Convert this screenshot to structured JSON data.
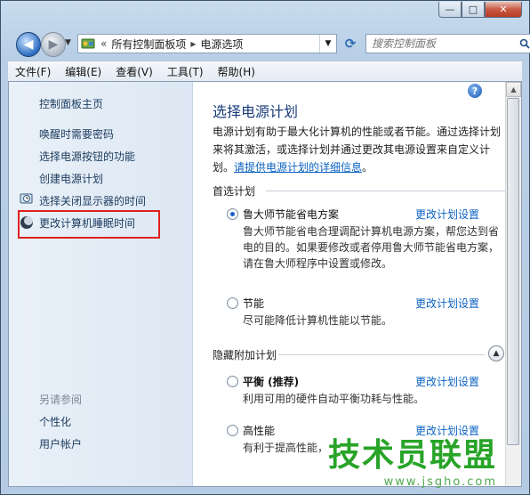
{
  "window": {
    "buttons": {
      "minimize": "—",
      "maximize": "□",
      "close": "✕"
    }
  },
  "nav": {
    "breadcrumb_sep": "«",
    "path": [
      "所有控制面板项",
      "电源选项"
    ],
    "path_arrow": "▸",
    "search_placeholder": "搜索控制面板"
  },
  "menu": [
    "文件(F)",
    "编辑(E)",
    "查看(V)",
    "工具(T)",
    "帮助(H)"
  ],
  "sidebar": {
    "items": [
      "控制面板主页",
      "唤醒时需要密码",
      "选择电源按钮的功能",
      "创建电源计划",
      "选择关闭显示器的时间",
      "更改计算机睡眠时间"
    ],
    "see_also_heading": "另请参阅",
    "see_also": [
      "个性化",
      "用户帐户"
    ]
  },
  "main": {
    "title": "选择电源计划",
    "intro": "电源计划有助于最大化计算机的性能或者节能。通过选择计划来将其激活，或选择计划并通过更改其电源设置来自定义计划。",
    "intro_link": "请提供电源计划的详细信息",
    "intro_end": "。",
    "preferred_heading": "首选计划",
    "hidden_heading": "隐藏附加计划",
    "change_link": "更改计划设置",
    "plans": [
      {
        "name": "鲁大师节能省电方案",
        "desc": "鲁大师节能省电合理调配计算机电源方案，帮您达到省电的目的。如果要修改或者停用鲁大师节能省电方案，请在鲁大师程序中设置或修改。",
        "checked": true
      },
      {
        "name": "节能",
        "desc": "尽可能降低计算机性能以节能。",
        "checked": false
      },
      {
        "name": "平衡 (推荐)",
        "desc": "利用可用的硬件自动平衡功耗与性能。",
        "checked": false
      },
      {
        "name": "高性能",
        "desc": "有利于提高性能，",
        "checked": false
      }
    ]
  },
  "watermark": {
    "text": "技术员联盟",
    "url": "www.jsgho.com"
  },
  "colors": {
    "link": "#0c63c2",
    "title": "#1a3c78",
    "highlight": "#e02020"
  }
}
